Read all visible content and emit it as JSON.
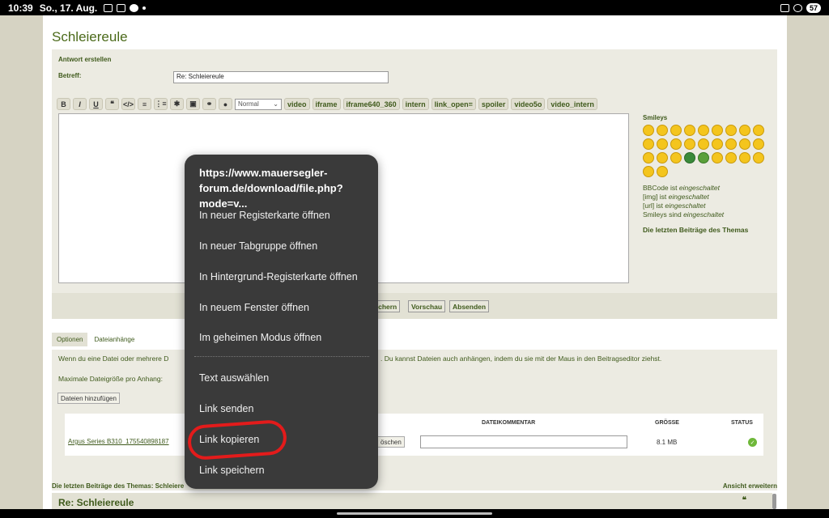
{
  "status_bar": {
    "time": "10:39",
    "date": "So., 17. Aug.",
    "battery": "57"
  },
  "page": {
    "title": "Schleiereule",
    "reply_heading": "Antwort erstellen",
    "subject_label": "Betreff:",
    "subject_value": "Re: Schleiereule"
  },
  "toolbar": {
    "buttons": [
      "B",
      "I",
      "U",
      "❝",
      "</>",
      "≡",
      "⋮≡",
      "✱",
      "▣",
      "⚭",
      "●"
    ],
    "font_size_select": "Normal",
    "tags": [
      "video",
      "iframe",
      "iframe640_360",
      "intern",
      "link_open=",
      "spoiler",
      "video5o",
      "video_intern"
    ]
  },
  "sidebar": {
    "smileys_heading": "Smileys",
    "bbcode_prefix": "BBCode ist ",
    "bbcode_state": "eingeschaltet",
    "img_prefix": "[img] ist ",
    "img_state": "eingeschaltet",
    "url_prefix": "[url] ist ",
    "url_state": "eingeschaltet",
    "smileys_prefix": "Smileys sind ",
    "smileys_state": "eingeschaltet",
    "recent_posts_link": "Die letzten Beiträge des Themas"
  },
  "actions": {
    "save_partial": "eichern",
    "preview": "Vorschau",
    "submit": "Absenden"
  },
  "tabs": {
    "options": "Optionen",
    "attachments": "Dateianhänge"
  },
  "attachments": {
    "info_left": "Wenn du eine Datei oder mehrere D",
    "info_right": ". Du kannst Dateien auch anhängen, indem du sie mit der Maus in den Beitragseditor ziehst.",
    "max_size": "Maximale Dateigröße pro Anhang:",
    "add_button": "Dateien hinzufügen",
    "col_comment": "DATEIKOMMENTAR",
    "col_size": "GRÖSSE",
    "col_status": "STATUS",
    "file_name": "Argus Series B310_175540898187",
    "delete_partial": "öschen",
    "file_size": "8.1 MB",
    "status_icon": "check-circle-icon"
  },
  "recent": {
    "label": "Die letzten Beiträge des Themas: Schleiere",
    "expand": "Ansicht erweitern",
    "post_title": "Re: Schleiereule"
  },
  "context_menu": {
    "url": "https://www.mauersegler-forum.de/download/file.php?mode=v...",
    "items": [
      "In neuer Registerkarte öffnen",
      "In neuer Tabgruppe öffnen",
      "In Hintergrund-Registerkarte öffnen",
      "In neuem Fenster öffnen",
      "Im geheimen Modus öffnen",
      "Text auswählen",
      "Link senden",
      "Link kopieren",
      "Link speichern"
    ]
  },
  "colors": {
    "accent": "#3f5a1c",
    "menu_bg": "#3a3a3a",
    "highlight": "#e31b1b"
  }
}
